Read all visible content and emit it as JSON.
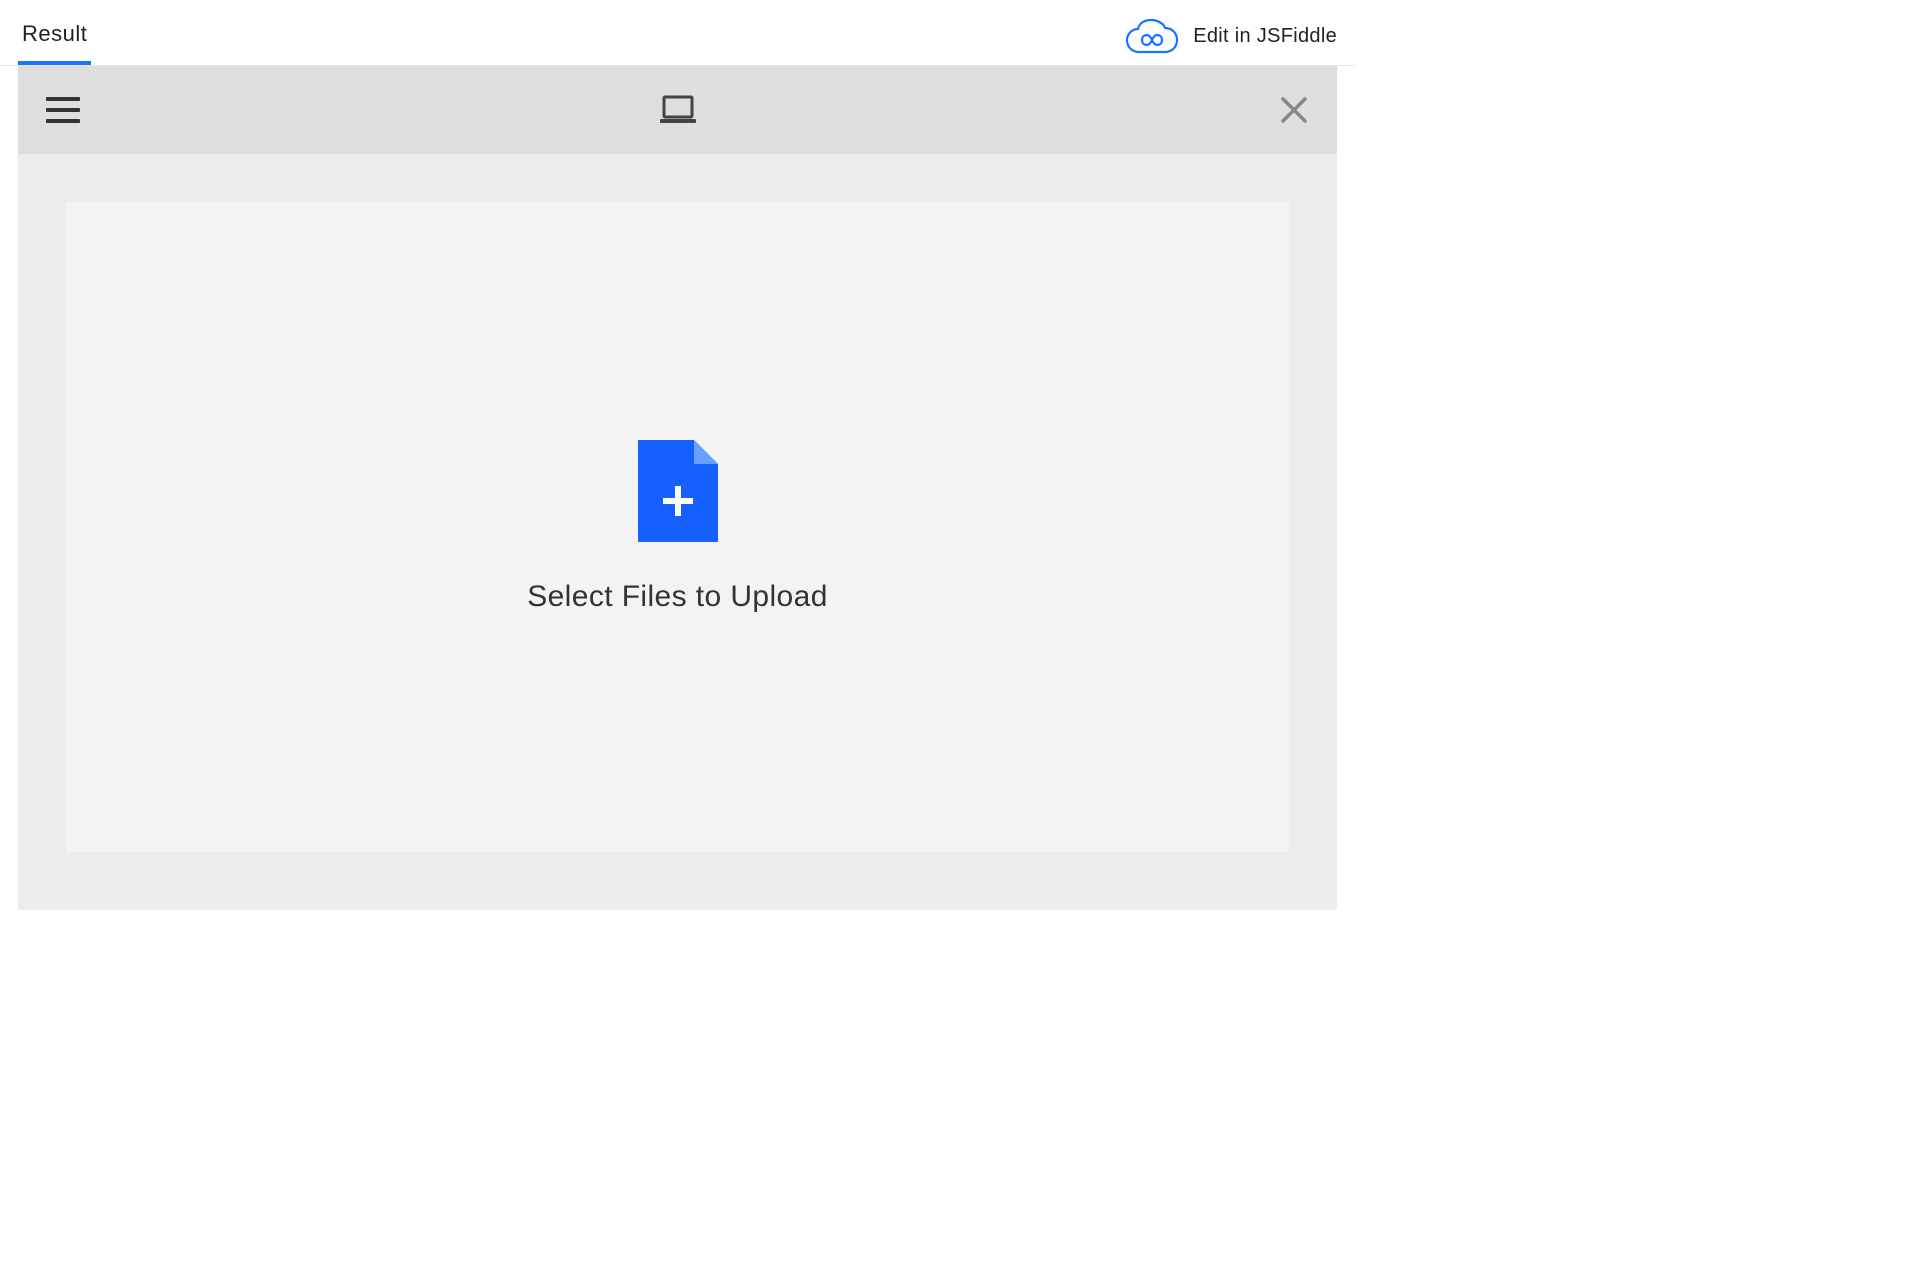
{
  "tabs": {
    "result_label": "Result"
  },
  "header_right": {
    "edit_label": "Edit in JSFiddle"
  },
  "uploader": {
    "prompt": "Select Files to Upload"
  },
  "colors": {
    "accent_blue": "#1a73ff",
    "file_icon_blue": "#1560ff",
    "toolbar_bg": "#dedede",
    "panel_bg": "#ececec",
    "dropzone_bg": "#f3f3f3"
  }
}
